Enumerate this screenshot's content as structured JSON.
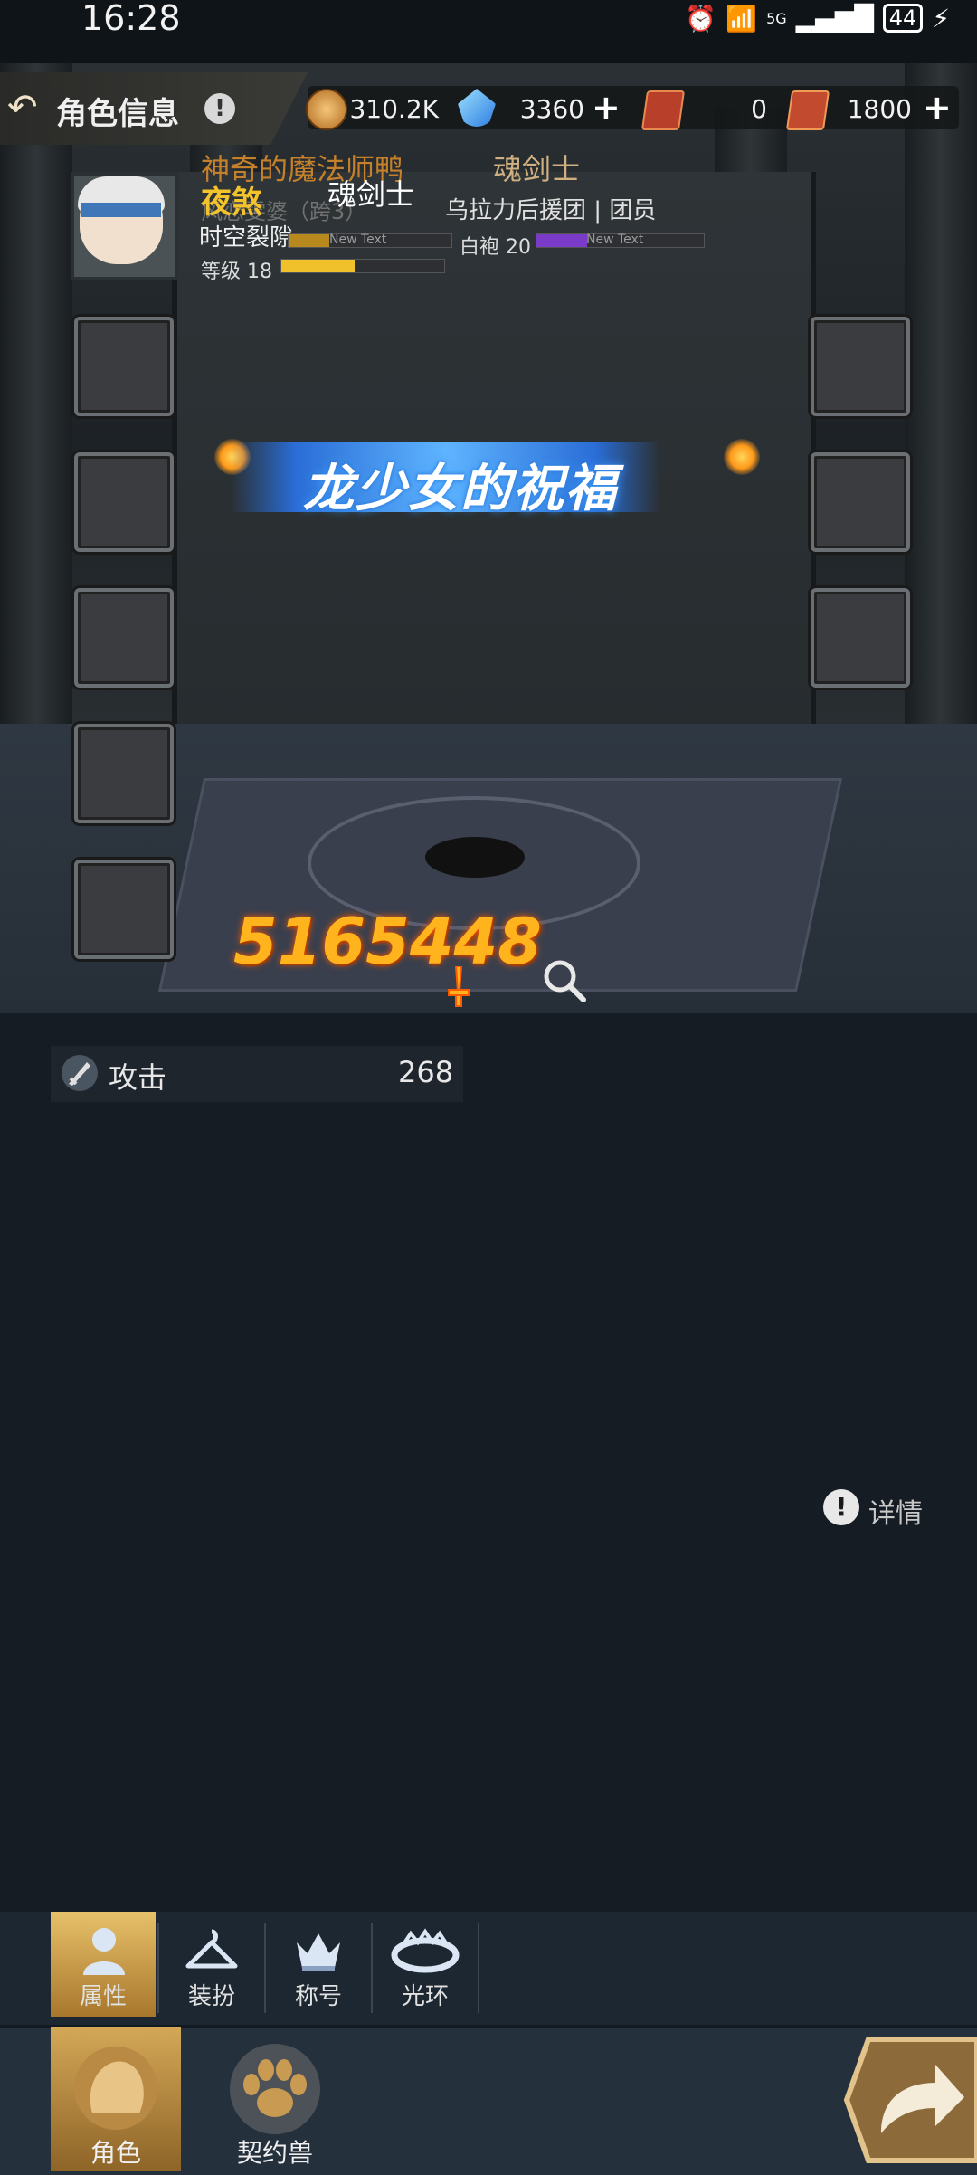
{
  "status_bar": {
    "time": "16:28",
    "signal": "5G",
    "battery": "44"
  },
  "header": {
    "title": "角色信息",
    "info_icon": "!"
  },
  "resources": [
    {
      "icon": "gold-coin-icon",
      "value": "310.2K",
      "has_plus": false
    },
    {
      "icon": "crystal-icon",
      "value": "3360",
      "has_plus": true
    },
    {
      "icon": "ticket-icon",
      "value": "0",
      "has_plus": false
    },
    {
      "icon": "point-card-icon",
      "value": "1800",
      "has_plus": true
    }
  ],
  "profile": {
    "guild_name": "神奇的魔法师鸭",
    "class_top": "魂剑士",
    "character_name": "夜煞",
    "class_name": "魂剑士",
    "server": "风恋雯婆（跨3）",
    "alliance": "乌拉力后援团",
    "role": "团员",
    "server_line2": "时空裂隙",
    "bar_label_1": "New Text",
    "white_robe": "白袍 20",
    "bar_label_2": "New Text",
    "level": "等级 18",
    "level_fill": 0.45,
    "bar1_fill": 0.25,
    "bar2_fill": 0.3
  },
  "banner": {
    "text": "龙少女的祝福"
  },
  "combat_power": "5165448",
  "stats": [
    {
      "label": "攻击",
      "value": "268"
    }
  ],
  "detail": {
    "label": "详情"
  },
  "tabs": [
    {
      "label": "属性",
      "active": true,
      "icon": "person-icon"
    },
    {
      "label": "装扮",
      "active": false,
      "icon": "hanger-icon"
    },
    {
      "label": "称号",
      "active": false,
      "icon": "crown-icon"
    },
    {
      "label": "光环",
      "active": false,
      "icon": "halo-icon"
    }
  ],
  "bottom_tabs": [
    {
      "label": "角色",
      "active": true,
      "icon": "character-icon"
    },
    {
      "label": "契约兽",
      "active": false,
      "icon": "paw-icon"
    }
  ],
  "colors": {
    "accent_gold": "#f3c32c",
    "power_orange": "#ffb41e",
    "bg": "#151c24",
    "active_tab": "#c89a4a"
  }
}
